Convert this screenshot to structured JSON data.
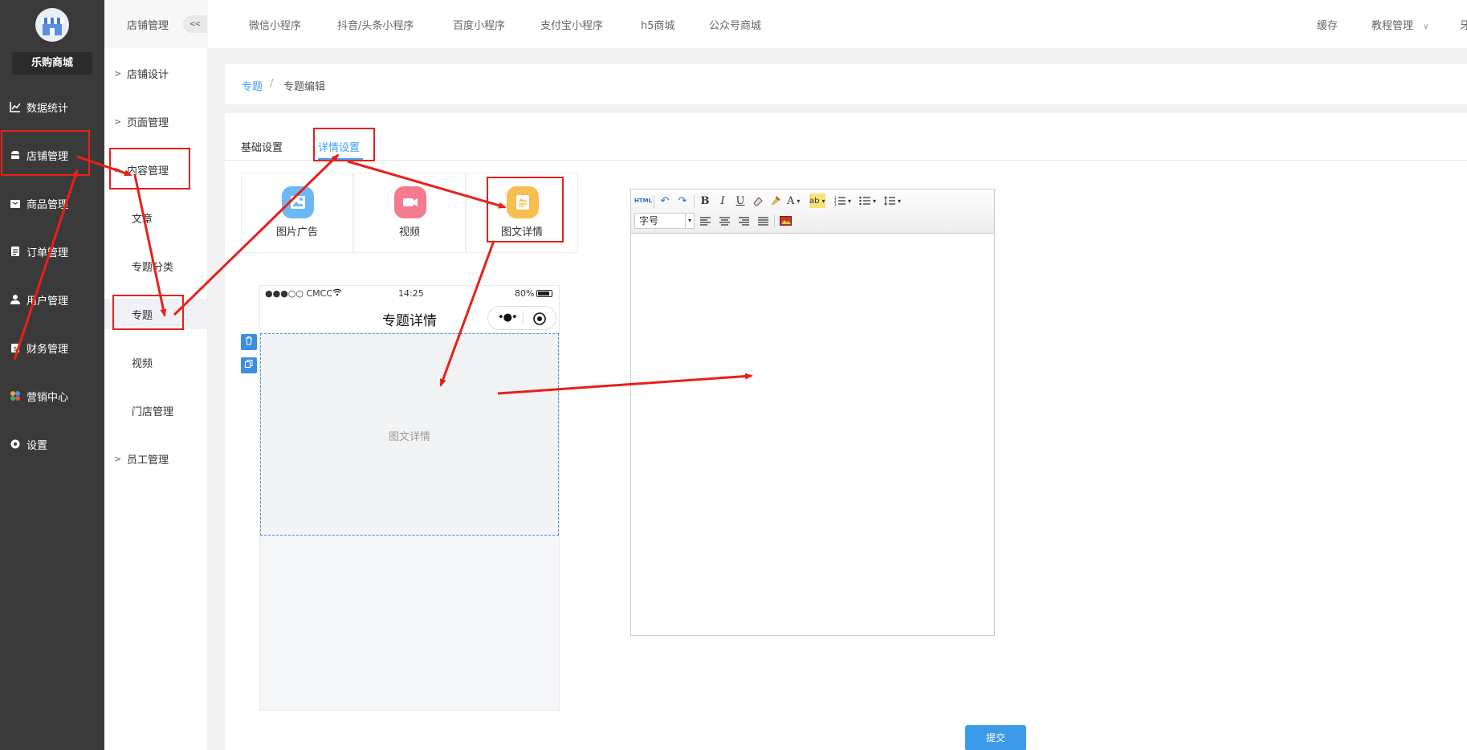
{
  "app": {
    "brand": "乐购商城"
  },
  "sidebar": {
    "items": [
      {
        "label": "数据统计",
        "icon": "chart-icon"
      },
      {
        "label": "店铺管理",
        "icon": "store-icon"
      },
      {
        "label": "商品管理",
        "icon": "goods-icon"
      },
      {
        "label": "订单管理",
        "icon": "order-icon"
      },
      {
        "label": "用户管理",
        "icon": "user-icon"
      },
      {
        "label": "财务管理",
        "icon": "finance-icon"
      },
      {
        "label": "营销中心",
        "icon": "marketing-icon"
      },
      {
        "label": "设置",
        "icon": "settings-icon"
      }
    ]
  },
  "submenu": {
    "title": "店铺管理",
    "collapse_label": "<<",
    "items": [
      {
        "label": "店铺设计"
      },
      {
        "label": "页面管理"
      },
      {
        "label": "内容管理"
      },
      {
        "label": "文章"
      },
      {
        "label": "专题分类"
      },
      {
        "label": "专题"
      },
      {
        "label": "视频"
      },
      {
        "label": "门店管理"
      },
      {
        "label": "员工管理"
      }
    ]
  },
  "topnav": {
    "tabs": [
      "微信小程序",
      "抖音/头条小程序",
      "百度小程序",
      "支付宝小程序",
      "h5商城",
      "公众号商城"
    ],
    "right": {
      "cache": "缓存",
      "tutorial": "教程管理",
      "cut_char": "牙"
    }
  },
  "breadcrumb": {
    "parent": "专题",
    "separator": "/",
    "current": "专题编辑"
  },
  "tabs": {
    "basic": "基础设置",
    "detail": "详情设置"
  },
  "components": [
    {
      "label": "图片广告",
      "icon": "image-ad-icon"
    },
    {
      "label": "视频",
      "icon": "video-icon"
    },
    {
      "label": "图文详情",
      "icon": "rich-text-icon"
    }
  ],
  "phone": {
    "carrier": "●●●○○ CMCC",
    "time": "14:25",
    "battery": "80%",
    "title": "专题详情",
    "block_label": "图文详情"
  },
  "editor": {
    "html_label": "HTML",
    "font_size_label": "字号",
    "tools": [
      "undo-icon",
      "redo-icon",
      "bold-icon",
      "italic-icon",
      "underline-icon",
      "eraser-icon",
      "format-brush-icon",
      "font-color-icon",
      "highlight-icon",
      "ordered-list-icon",
      "unordered-list-icon",
      "line-height-icon",
      "align-left-icon",
      "align-center-icon",
      "align-right-icon",
      "justify-icon",
      "image-icon"
    ]
  },
  "submit_label": "提交",
  "colors": {
    "accent": "#3c9be8",
    "annotation": "#e8201a",
    "sidebar": "#3a3a3a",
    "link": "#409eff"
  }
}
